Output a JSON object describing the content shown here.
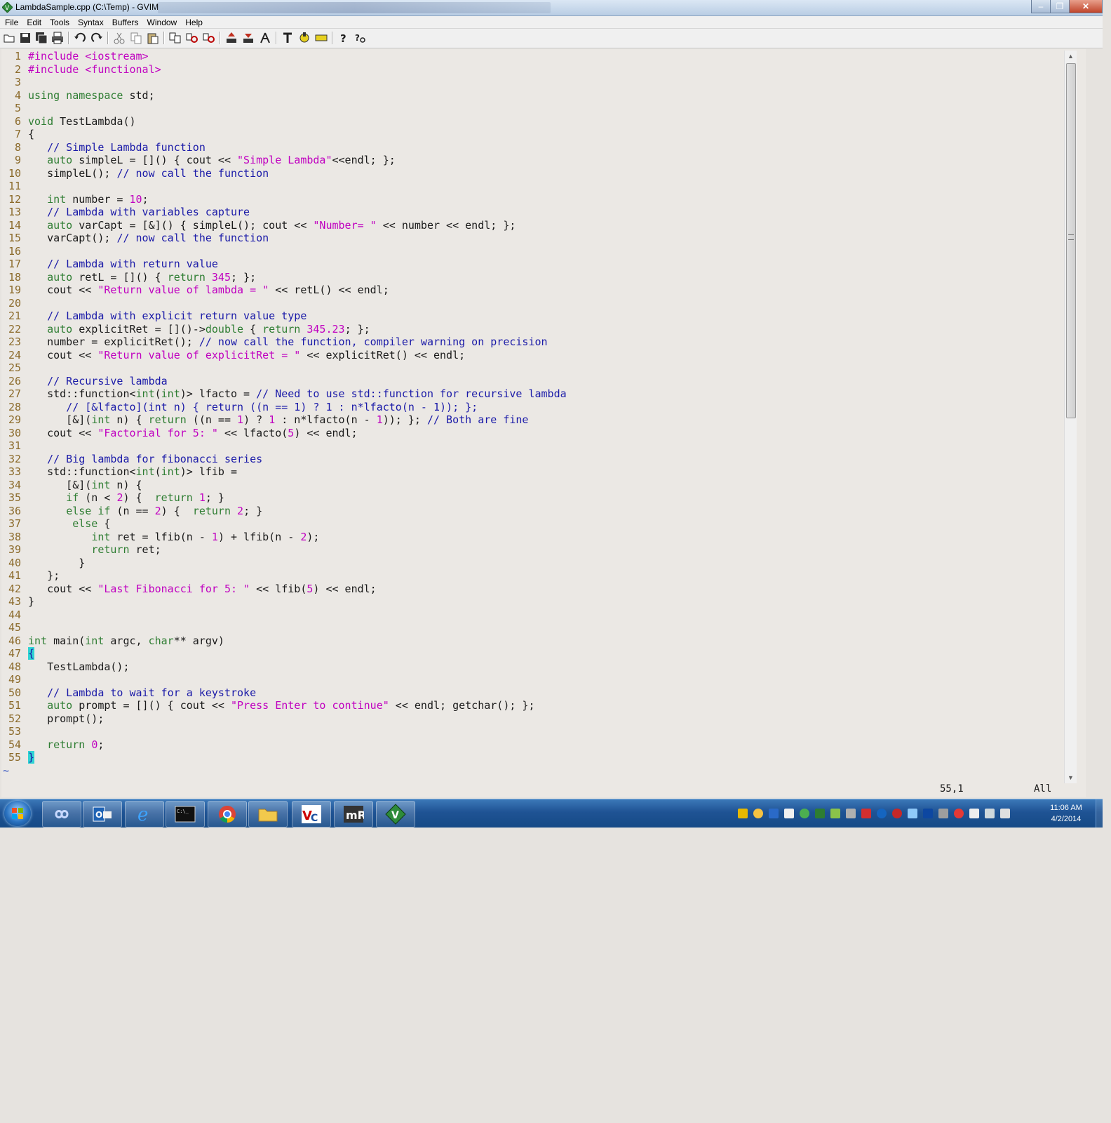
{
  "window": {
    "title": "LambdaSample.cpp (C:\\Temp) - GVIM",
    "min_label": "–",
    "max_label": "❐",
    "close_label": "✕"
  },
  "menu": [
    "File",
    "Edit",
    "Tools",
    "Syntax",
    "Buffers",
    "Window",
    "Help"
  ],
  "code_lines": [
    [
      [
        "pp",
        "#include <iostream>"
      ]
    ],
    [
      [
        "pp",
        "#include <functional>"
      ]
    ],
    [],
    [
      [
        "kw",
        "using namespace"
      ],
      [
        "tx",
        " std;"
      ]
    ],
    [],
    [
      [
        "ty",
        "void"
      ],
      [
        "tx",
        " TestLambda()"
      ]
    ],
    [
      [
        "tx",
        "{"
      ]
    ],
    [
      [
        "tx",
        "   "
      ],
      [
        "cm",
        "// Simple Lambda function"
      ]
    ],
    [
      [
        "tx",
        "   "
      ],
      [
        "ty",
        "auto"
      ],
      [
        "tx",
        " simpleL = []() { cout << "
      ],
      [
        "st",
        "\"Simple Lambda\""
      ],
      [
        "tx",
        "<<endl; };"
      ]
    ],
    [
      [
        "tx",
        "   simpleL(); "
      ],
      [
        "cm",
        "// now call the function"
      ]
    ],
    [],
    [
      [
        "tx",
        "   "
      ],
      [
        "ty",
        "int"
      ],
      [
        "tx",
        " number = "
      ],
      [
        "nm",
        "10"
      ],
      [
        "tx",
        ";"
      ]
    ],
    [
      [
        "tx",
        "   "
      ],
      [
        "cm",
        "// Lambda with variables capture"
      ]
    ],
    [
      [
        "tx",
        "   "
      ],
      [
        "ty",
        "auto"
      ],
      [
        "tx",
        " varCapt = [&]() { simpleL(); cout << "
      ],
      [
        "st",
        "\"Number= \""
      ],
      [
        "tx",
        " << number << endl; };"
      ]
    ],
    [
      [
        "tx",
        "   varCapt(); "
      ],
      [
        "cm",
        "// now call the function"
      ]
    ],
    [],
    [
      [
        "tx",
        "   "
      ],
      [
        "cm",
        "// Lambda with return value"
      ]
    ],
    [
      [
        "tx",
        "   "
      ],
      [
        "ty",
        "auto"
      ],
      [
        "tx",
        " retL = []() { "
      ],
      [
        "kw",
        "return"
      ],
      [
        "tx",
        " "
      ],
      [
        "nm",
        "345"
      ],
      [
        "tx",
        "; };"
      ]
    ],
    [
      [
        "tx",
        "   cout << "
      ],
      [
        "st",
        "\"Return value of lambda = \""
      ],
      [
        "tx",
        " << retL() << endl;"
      ]
    ],
    [],
    [
      [
        "tx",
        "   "
      ],
      [
        "cm",
        "// Lambda with explicit return value type"
      ]
    ],
    [
      [
        "tx",
        "   "
      ],
      [
        "ty",
        "auto"
      ],
      [
        "tx",
        " explicitRet = []()->"
      ],
      [
        "ty",
        "double"
      ],
      [
        "tx",
        " { "
      ],
      [
        "kw",
        "return"
      ],
      [
        "tx",
        " "
      ],
      [
        "nm",
        "345.23"
      ],
      [
        "tx",
        "; };"
      ]
    ],
    [
      [
        "tx",
        "   number = explicitRet(); "
      ],
      [
        "cm",
        "// now call the function, compiler warning on precision"
      ]
    ],
    [
      [
        "tx",
        "   cout << "
      ],
      [
        "st",
        "\"Return value of explicitRet = \""
      ],
      [
        "tx",
        " << explicitRet() << endl;"
      ]
    ],
    [],
    [
      [
        "tx",
        "   "
      ],
      [
        "cm",
        "// Recursive lambda"
      ]
    ],
    [
      [
        "tx",
        "   std::function<"
      ],
      [
        "ty",
        "int"
      ],
      [
        "tx",
        "("
      ],
      [
        "ty",
        "int"
      ],
      [
        "tx",
        ")> lfacto = "
      ],
      [
        "cm",
        "// Need to use std::function for recursive lambda"
      ]
    ],
    [
      [
        "tx",
        "      "
      ],
      [
        "cm",
        "// [&lfacto](int n) { return ((n == 1) ? 1 : n*lfacto(n - 1)); };"
      ]
    ],
    [
      [
        "tx",
        "      [&]("
      ],
      [
        "ty",
        "int"
      ],
      [
        "tx",
        " n) { "
      ],
      [
        "kw",
        "return"
      ],
      [
        "tx",
        " ((n == "
      ],
      [
        "nm",
        "1"
      ],
      [
        "tx",
        ") ? "
      ],
      [
        "nm",
        "1"
      ],
      [
        "tx",
        " : n*lfacto(n - "
      ],
      [
        "nm",
        "1"
      ],
      [
        "tx",
        ")); }; "
      ],
      [
        "cm",
        "// Both are fine"
      ]
    ],
    [
      [
        "tx",
        "   cout << "
      ],
      [
        "st",
        "\"Factorial for 5: \""
      ],
      [
        "tx",
        " << lfacto("
      ],
      [
        "nm",
        "5"
      ],
      [
        "tx",
        ") << endl;"
      ]
    ],
    [],
    [
      [
        "tx",
        "   "
      ],
      [
        "cm",
        "// Big lambda for fibonacci series"
      ]
    ],
    [
      [
        "tx",
        "   std::function<"
      ],
      [
        "ty",
        "int"
      ],
      [
        "tx",
        "("
      ],
      [
        "ty",
        "int"
      ],
      [
        "tx",
        ")> lfib ="
      ]
    ],
    [
      [
        "tx",
        "      [&]("
      ],
      [
        "ty",
        "int"
      ],
      [
        "tx",
        " n) {"
      ]
    ],
    [
      [
        "tx",
        "      "
      ],
      [
        "kw",
        "if"
      ],
      [
        "tx",
        " (n < "
      ],
      [
        "nm",
        "2"
      ],
      [
        "tx",
        ") {  "
      ],
      [
        "kw",
        "return"
      ],
      [
        "tx",
        " "
      ],
      [
        "nm",
        "1"
      ],
      [
        "tx",
        "; }"
      ]
    ],
    [
      [
        "tx",
        "      "
      ],
      [
        "kw",
        "else if"
      ],
      [
        "tx",
        " (n == "
      ],
      [
        "nm",
        "2"
      ],
      [
        "tx",
        ") {  "
      ],
      [
        "kw",
        "return"
      ],
      [
        "tx",
        " "
      ],
      [
        "nm",
        "2"
      ],
      [
        "tx",
        "; }"
      ]
    ],
    [
      [
        "tx",
        "       "
      ],
      [
        "kw",
        "else"
      ],
      [
        "tx",
        " {"
      ]
    ],
    [
      [
        "tx",
        "          "
      ],
      [
        "ty",
        "int"
      ],
      [
        "tx",
        " ret = lfib(n - "
      ],
      [
        "nm",
        "1"
      ],
      [
        "tx",
        ") + lfib(n - "
      ],
      [
        "nm",
        "2"
      ],
      [
        "tx",
        ");"
      ]
    ],
    [
      [
        "tx",
        "          "
      ],
      [
        "kw",
        "return"
      ],
      [
        "tx",
        " ret;"
      ]
    ],
    [
      [
        "tx",
        "        }"
      ]
    ],
    [
      [
        "tx",
        "   };"
      ]
    ],
    [
      [
        "tx",
        "   cout << "
      ],
      [
        "st",
        "\"Last Fibonacci for 5: \""
      ],
      [
        "tx",
        " << lfib("
      ],
      [
        "nm",
        "5"
      ],
      [
        "tx",
        ") << endl;"
      ]
    ],
    [
      [
        "tx",
        "}"
      ]
    ],
    [],
    [],
    [
      [
        "ty",
        "int"
      ],
      [
        "tx",
        " main("
      ],
      [
        "ty",
        "int"
      ],
      [
        "tx",
        " argc, "
      ],
      [
        "ty",
        "char"
      ],
      [
        "tx",
        "** argv)"
      ]
    ],
    [
      [
        "br",
        "{"
      ]
    ],
    [
      [
        "tx",
        "   TestLambda();"
      ]
    ],
    [],
    [
      [
        "tx",
        "   "
      ],
      [
        "cm",
        "// Lambda to wait for a keystroke"
      ]
    ],
    [
      [
        "tx",
        "   "
      ],
      [
        "ty",
        "auto"
      ],
      [
        "tx",
        " prompt = []() { cout << "
      ],
      [
        "st",
        "\"Press Enter to continue\""
      ],
      [
        "tx",
        " << endl; getchar(); };"
      ]
    ],
    [
      [
        "tx",
        "   prompt();"
      ]
    ],
    [],
    [
      [
        "tx",
        "   "
      ],
      [
        "kw",
        "return"
      ],
      [
        "tx",
        " "
      ],
      [
        "nm",
        "0"
      ],
      [
        "tx",
        ";"
      ]
    ],
    [
      [
        "br",
        "}"
      ]
    ]
  ],
  "tilde": "~",
  "status": {
    "cursor_pos": "55,1",
    "scroll_pos": "All"
  },
  "clock": {
    "time": "11:06 AM",
    "date": "4/2/2014"
  },
  "colors": {
    "preproc": "#c000c0",
    "string": "#c000c0",
    "keyword": "#2e7d32",
    "comment": "#1a1aa8",
    "line_number": "#8b6a2a",
    "bracket_highlight": "#2fd3d3"
  }
}
